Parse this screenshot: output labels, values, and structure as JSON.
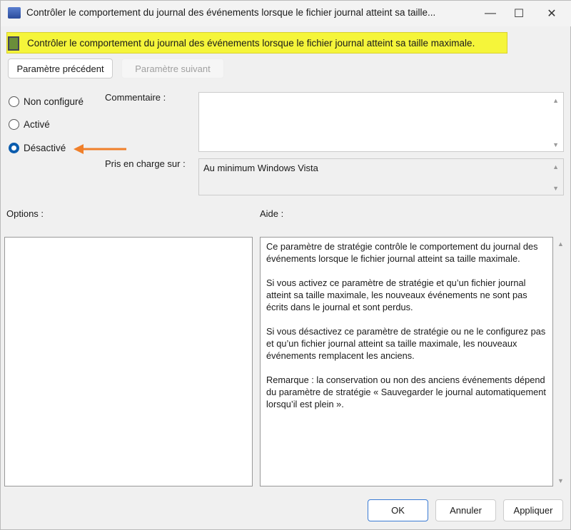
{
  "window": {
    "title": "Contrôler le comportement du journal des événements lorsque le fichier journal atteint sa taille...",
    "minimize": "—",
    "maximize": "☐",
    "close": "✕"
  },
  "banner": {
    "text": "Contrôler le comportement du journal des événements lorsque le fichier journal atteint sa taille maximale."
  },
  "nav": {
    "prev": "Paramètre précédent",
    "next": "Paramètre suivant"
  },
  "state": {
    "options": [
      "Non configuré",
      "Activé",
      "Désactivé"
    ],
    "selected": "Désactivé"
  },
  "comment": {
    "label": "Commentaire :",
    "value": ""
  },
  "supported": {
    "label": "Pris en charge sur :",
    "value": "Au minimum Windows Vista"
  },
  "options_label": "Options :",
  "help_label": "Aide :",
  "help": [
    "Ce paramètre de stratégie contrôle le comportement du journal des événements lorsque le fichier journal atteint sa taille maximale.",
    "Si vous activez ce paramètre de stratégie et qu’un fichier journal atteint sa taille maximale, les nouveaux événements ne sont pas écrits dans le journal et sont perdus.",
    "Si vous désactivez ce paramètre de stratégie ou ne le configurez pas et qu’un fichier journal atteint sa taille maximale, les nouveaux événements remplacent les anciens.",
    "Remarque : la conservation ou non des anciens événements dépend du paramètre de stratégie « Sauvegarder le journal automatiquement lorsqu’il est plein »."
  ],
  "buttons": {
    "ok": "OK",
    "cancel": "Annuler",
    "apply": "Appliquer"
  },
  "annotation_color": "#f07f2a"
}
